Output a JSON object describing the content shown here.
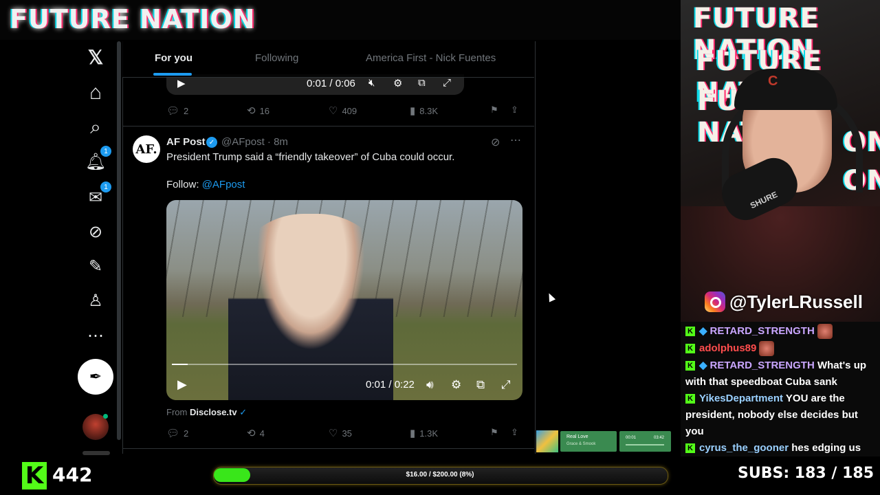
{
  "banner": {
    "title": "FUTURE NATION"
  },
  "x_nav": {
    "items": [
      {
        "name": "x-logo-icon",
        "glyph": "𝕏"
      },
      {
        "name": "home-icon",
        "glyph": "⌂"
      },
      {
        "name": "search-icon",
        "glyph": "⌕"
      },
      {
        "name": "notifications-icon",
        "glyph": "🔔︎",
        "badge": "1"
      },
      {
        "name": "messages-icon",
        "glyph": "✉",
        "badge": "1"
      },
      {
        "name": "grok-icon",
        "glyph": "⊘"
      },
      {
        "name": "lists-icon",
        "glyph": "✎"
      },
      {
        "name": "profile-icon",
        "glyph": "♙"
      },
      {
        "name": "more-icon",
        "glyph": "⋯"
      }
    ],
    "post_glyph": "✒"
  },
  "tabs": {
    "for_you": "For you",
    "following": "Following",
    "list": "America First - Nick Fuentes"
  },
  "prev_tweet": {
    "video_time": "0:01 / 0:06",
    "replies": "2",
    "reposts": "16",
    "likes": "409",
    "views": "8.3K"
  },
  "tweet": {
    "avatar_text": "AF.",
    "name": "AF Post",
    "handle": "@AFpost · 8m",
    "text": "President Trump said a “friendly takeover” of Cuba could occur.",
    "follow_label": "Follow: ",
    "follow_link": "@AFpost",
    "video_time": "0:01 / 0:22",
    "video_progress": 0.045,
    "from_label": "From ",
    "from_source": "Disclose.tv",
    "replies": "2",
    "reposts": "4",
    "likes": "35",
    "views": "1.3K"
  },
  "webcam": {
    "watermark": [
      "FUTURE NATION",
      "FUTURE NATION",
      "FUTURE NATION",
      "ON",
      "ON"
    ],
    "cap_logo": "C",
    "mic_brand": "SHURE",
    "instagram_handle": "@TylerLRussell"
  },
  "chat": [
    {
      "user": "RETARD_STRENGTH",
      "color": "#c9a6ff",
      "gem": true,
      "text": "",
      "emote": true
    },
    {
      "user": "adolphus89",
      "color": "#ff4d4d",
      "gem": false,
      "text": "",
      "emote": true
    },
    {
      "user": "RETARD_STRENGTH",
      "color": "#c9a6ff",
      "gem": true,
      "text": "What's up with that speedboat Cuba sank",
      "emote": false
    },
    {
      "user": "YikesDepartment",
      "color": "#9ad0ff",
      "gem": false,
      "text": "YOU are the president, nobody else decides but you",
      "emote": false
    },
    {
      "user": "cyrus_the_gooner",
      "color": "#9ad0ff",
      "gem": false,
      "text": "hes edging us",
      "emote": false
    }
  ],
  "now_playing": {
    "title": "Real Love",
    "artist": "Grace & Smook",
    "time_elapsed": "00:01",
    "time_total": "03:42"
  },
  "bottom": {
    "kick_logo": "K",
    "viewers": "442",
    "goal_text": "$16.00 / $200.00 (8%)",
    "goal_fraction": 0.08,
    "subs_label": "SUBS:",
    "subs_value": "183 / 185"
  },
  "colors": {
    "accent": "#1d9bf0",
    "kick_green": "#53fc18",
    "muted": "#71767b"
  }
}
